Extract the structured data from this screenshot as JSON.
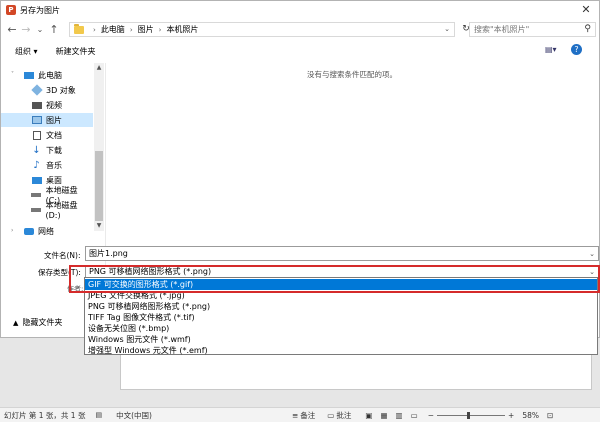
{
  "dialog": {
    "title": "另存为图片",
    "close_glyph": "✕"
  },
  "nav": {
    "back": "←",
    "forward": "→",
    "recent": "⌄",
    "up": "↑",
    "breadcrumb": [
      "此电脑",
      "图片",
      "本机照片"
    ],
    "search_placeholder": "搜索\"本机照片\""
  },
  "toolbar": {
    "organize": "组织 ▾",
    "new_folder": "新建文件夹"
  },
  "sidebar": {
    "items": [
      {
        "label": "此电脑",
        "icon": "computer-icon"
      },
      {
        "label": "3D 对象",
        "icon": "3d-objects-icon"
      },
      {
        "label": "视频",
        "icon": "video-icon"
      },
      {
        "label": "图片",
        "icon": "pictures-icon"
      },
      {
        "label": "文档",
        "icon": "documents-icon"
      },
      {
        "label": "下载",
        "icon": "download-icon"
      },
      {
        "label": "音乐",
        "icon": "music-icon"
      },
      {
        "label": "桌面",
        "icon": "desktop-icon"
      },
      {
        "label": "本地磁盘 (C:)",
        "icon": "drive-icon"
      },
      {
        "label": "本地磁盘 (D:)",
        "icon": "drive-icon"
      },
      {
        "label": "网络",
        "icon": "network-icon"
      }
    ]
  },
  "content": {
    "empty_message": "没有与搜索条件匹配的项。"
  },
  "form": {
    "filename_label": "文件名(N):",
    "filename_value": "图片1.png",
    "filetype_label": "保存类型(T):",
    "filetype_value": "PNG 可移植网络图形格式 (*.png)",
    "authors_label": "作者:",
    "hide_folders": "隐藏文件夹",
    "options": [
      "GIF 可交换的图形格式 (*.gif)",
      "JPEG 文件交换格式 (*.jpg)",
      "PNG 可移植网络图形格式 (*.png)",
      "TIFF Tag 图像文件格式 (*.tif)",
      "设备无关位图 (*.bmp)",
      "Windows 图元文件 (*.wmf)",
      "增强型 Windows 元文件 (*.emf)"
    ]
  },
  "status": {
    "slide_info": "幻灯片 第 1 张，共 1 张",
    "language": "中文(中国)",
    "notes": "备注",
    "comments": "批注",
    "zoom": "58%"
  },
  "colors": {
    "accent": "#0078d7",
    "highlight_outline": "#d52b2b",
    "selected_nav": "#cce8ff"
  }
}
